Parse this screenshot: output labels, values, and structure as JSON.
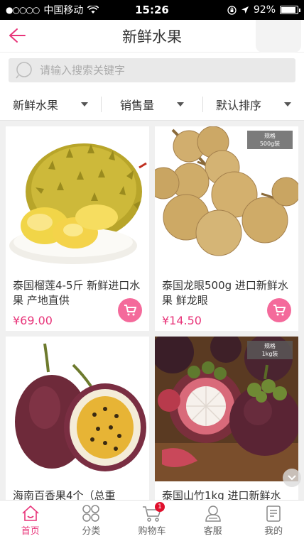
{
  "status_bar": {
    "signal": "●○○○○",
    "carrier": "中国移动",
    "time": "15:26",
    "battery_text": "92%",
    "battery_level": 0.92
  },
  "header": {
    "title": "新鲜水果"
  },
  "search": {
    "placeholder": "请输入搜索关键字"
  },
  "filters": [
    {
      "label": "新鲜水果"
    },
    {
      "label": "销售量"
    },
    {
      "label": "默认排序"
    }
  ],
  "products": [
    {
      "name": "泰国榴莲4-5斤 新鲜进口水果 产地直供",
      "price": "¥69.00",
      "image": "durian"
    },
    {
      "name": "泰国龙眼500g 进口新鲜水果 鲜龙眼",
      "price": "¥14.50",
      "image": "longan",
      "spec": [
        "规格",
        "500g装"
      ]
    },
    {
      "name": "海南百香果4个（总重",
      "price": "",
      "image": "passion-fruit"
    },
    {
      "name": "泰国山竹1kg 进口新鲜水",
      "price": "",
      "image": "mangosteen",
      "spec": [
        "规格",
        "1kg装"
      ]
    }
  ],
  "bottom_nav": [
    {
      "label": "首页",
      "icon": "home-icon",
      "active": true
    },
    {
      "label": "分类",
      "icon": "category-icon"
    },
    {
      "label": "购物车",
      "icon": "cart-icon",
      "badge": "1"
    },
    {
      "label": "客服",
      "icon": "service-icon"
    },
    {
      "label": "我的",
      "icon": "profile-icon"
    }
  ],
  "colors": {
    "accent": "#e8357a",
    "cart_button": "#f46a9b"
  }
}
